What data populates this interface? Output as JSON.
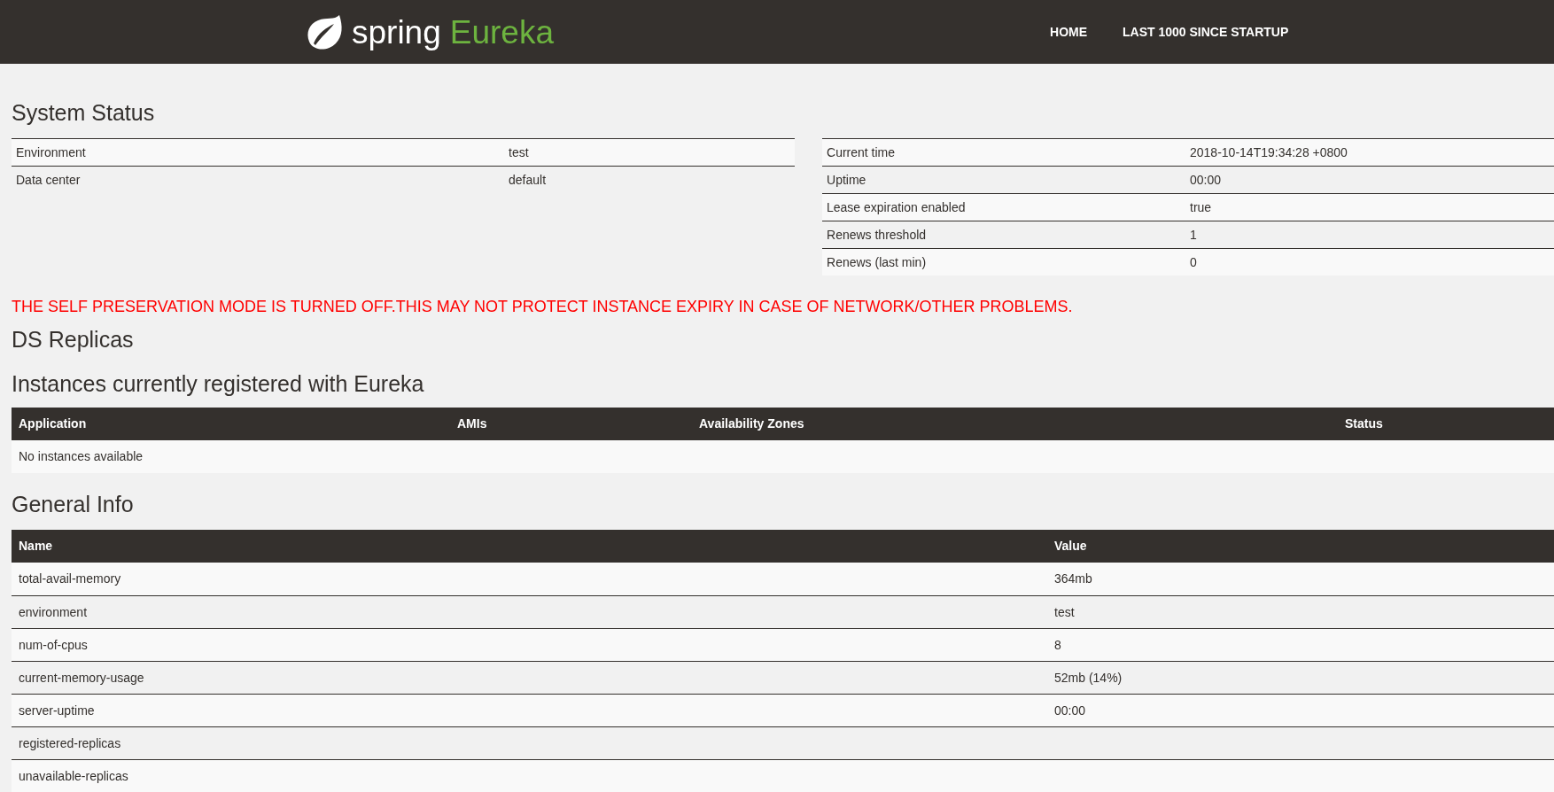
{
  "header": {
    "logo_word": "spring",
    "logo_product": "Eureka",
    "nav": [
      {
        "label": "HOME"
      },
      {
        "label": "LAST 1000 SINCE STARTUP"
      }
    ]
  },
  "system_status": {
    "title": "System Status",
    "left_rows": [
      {
        "name": "Environment",
        "value": "test"
      },
      {
        "name": "Data center",
        "value": "default"
      }
    ],
    "right_rows": [
      {
        "name": "Current time",
        "value": "2018-10-14T19:34:28 +0800"
      },
      {
        "name": "Uptime",
        "value": "00:00"
      },
      {
        "name": "Lease expiration enabled",
        "value": "true"
      },
      {
        "name": "Renews threshold",
        "value": "1"
      },
      {
        "name": "Renews (last min)",
        "value": "0"
      }
    ]
  },
  "warning": "THE SELF PRESERVATION MODE IS TURNED OFF.THIS MAY NOT PROTECT INSTANCE EXPIRY IN CASE OF NETWORK/OTHER PROBLEMS.",
  "ds_replicas": {
    "title": "DS Replicas"
  },
  "instances": {
    "title": "Instances currently registered with Eureka",
    "columns": [
      "Application",
      "AMIs",
      "Availability Zones",
      "Status"
    ],
    "empty_message": "No instances available"
  },
  "general_info": {
    "title": "General Info",
    "columns": [
      "Name",
      "Value"
    ],
    "rows": [
      {
        "name": "total-avail-memory",
        "value": "364mb"
      },
      {
        "name": "environment",
        "value": "test"
      },
      {
        "name": "num-of-cpus",
        "value": "8"
      },
      {
        "name": "current-memory-usage",
        "value": "52mb (14%)"
      },
      {
        "name": "server-uptime",
        "value": "00:00"
      },
      {
        "name": "registered-replicas",
        "value": ""
      },
      {
        "name": "unavailable-replicas",
        "value": ""
      }
    ]
  }
}
